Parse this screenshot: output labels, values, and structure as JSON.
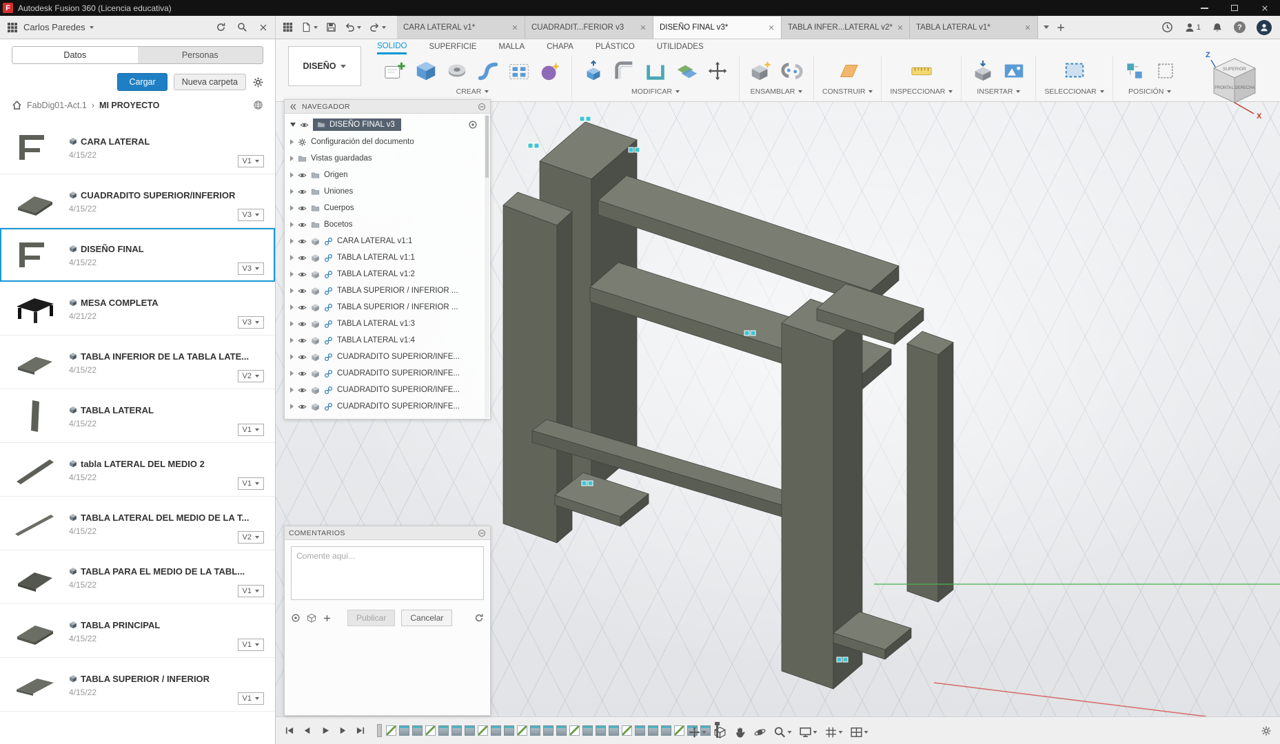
{
  "colors": {
    "accent": "#0696d7",
    "selection": "#1898d5"
  },
  "titlebar": {
    "logo": "F",
    "title": "Autodesk Fusion 360 (Licencia educativa)"
  },
  "appbar": {
    "user_name": "Carlos Paredes",
    "help_glyph": "?",
    "notification_count": "1",
    "tabs": [
      {
        "label": "CARA LATERAL v1*"
      },
      {
        "label": "CUADRADIT...FERIOR v3"
      },
      {
        "label": "DISEÑO FINAL v3*"
      },
      {
        "label": "TABLA INFER...LATERAL v2*"
      },
      {
        "label": "TABLA LATERAL v1*"
      }
    ]
  },
  "panel": {
    "tab_datos": "Datos",
    "tab_personas": "Personas",
    "upload": "Cargar",
    "new_folder": "Nueva carpeta",
    "breadcrumb_project": "FabDig01-Act.1",
    "breadcrumb_sep": "›",
    "breadcrumb_folder": "MI PROYECTO",
    "items": [
      {
        "title": "CARA LATERAL",
        "date": "4/15/22",
        "version": "V1"
      },
      {
        "title": "CUADRADITO SUPERIOR/INFERIOR",
        "date": "4/15/22",
        "version": "V3"
      },
      {
        "title": "DISEÑO FINAL",
        "date": "4/15/22",
        "version": "V3"
      },
      {
        "title": "MESA COMPLETA",
        "date": "4/21/22",
        "version": "V3"
      },
      {
        "title": "TABLA INFERIOR DE LA TABLA LATE...",
        "date": "4/15/22",
        "version": "V2"
      },
      {
        "title": "TABLA LATERAL",
        "date": "4/15/22",
        "version": "V1"
      },
      {
        "title": "tabla LATERAL DEL MEDIO 2",
        "date": "4/15/22",
        "version": "V1"
      },
      {
        "title": "TABLA LATERAL DEL MEDIO DE LA T...",
        "date": "4/15/22",
        "version": "V2"
      },
      {
        "title": "TABLA PARA EL MEDIO DE LA TABL...",
        "date": "4/15/22",
        "version": "V1"
      },
      {
        "title": "TABLA PRINCIPAL",
        "date": "4/15/22",
        "version": "V1"
      },
      {
        "title": "TABLA SUPERIOR / INFERIOR",
        "date": "4/15/22",
        "version": "V1"
      }
    ]
  },
  "ribbon": {
    "workspace": "DISEÑO",
    "tabs": [
      {
        "label": "SOLIDO"
      },
      {
        "label": "SUPERFICIE"
      },
      {
        "label": "MALLA"
      },
      {
        "label": "CHAPA"
      },
      {
        "label": "PLÁSTICO"
      },
      {
        "label": "UTILIDADES"
      }
    ],
    "groups": [
      {
        "label": "CREAR"
      },
      {
        "label": "MODIFICAR"
      },
      {
        "label": "ENSAMBLAR"
      },
      {
        "label": "CONSTRUIR"
      },
      {
        "label": "INSPECCIONAR"
      },
      {
        "label": "INSERTAR"
      },
      {
        "label": "SELECCIONAR"
      },
      {
        "label": "POSICIÓN"
      }
    ]
  },
  "navigator": {
    "title": "NAVEGADOR",
    "root_label": "DISEÑO FINAL v3",
    "nodes": [
      {
        "label": "Configuración del documento"
      },
      {
        "label": "Vistas guardadas"
      },
      {
        "label": "Origen"
      },
      {
        "label": "Uniones"
      },
      {
        "label": "Cuerpos"
      },
      {
        "label": "Bocetos"
      },
      {
        "label": "CARA LATERAL v1:1"
      },
      {
        "label": "TABLA LATERAL v1:1"
      },
      {
        "label": "TABLA LATERAL v1:2"
      },
      {
        "label": "TABLA SUPERIOR / INFERIOR ..."
      },
      {
        "label": "TABLA SUPERIOR / INFERIOR ..."
      },
      {
        "label": "TABLA LATERAL v1:3"
      },
      {
        "label": "TABLA LATERAL v1:4"
      },
      {
        "label": "CUADRADITO SUPERIOR/INFE..."
      },
      {
        "label": "CUADRADITO SUPERIOR/INFE..."
      },
      {
        "label": "CUADRADITO SUPERIOR/INFE..."
      },
      {
        "label": "CUADRADITO SUPERIOR/INFE..."
      }
    ]
  },
  "comments": {
    "title": "COMENTARIOS",
    "placeholder": "Comente aquí...",
    "publish": "Publicar",
    "cancel": "Cancelar"
  },
  "viewcube": {
    "top": "SUPERIOR",
    "left": "FRONTAL",
    "right": "DERECHA",
    "z": "Z",
    "x": "X"
  }
}
